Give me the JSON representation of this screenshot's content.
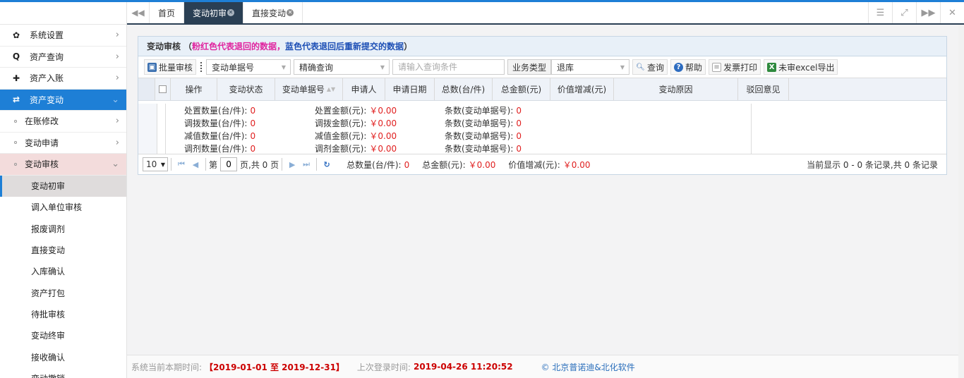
{
  "sidebar": {
    "menu": [
      {
        "icon": "✿",
        "label": "系统设置"
      },
      {
        "icon": "Q",
        "label": "资产查询"
      },
      {
        "icon": "✚",
        "label": "资产入账"
      },
      {
        "icon": "⇄",
        "label": "资产变动"
      }
    ],
    "sub": [
      {
        "label": "在账修改"
      },
      {
        "label": "变动申请"
      },
      {
        "label": "变动审核"
      }
    ],
    "leaves": [
      "变动初审",
      "调入单位审核",
      "报废调剂",
      "直接变动",
      "入库确认",
      "资产打包",
      "待批审核",
      "变动终审",
      "接收确认",
      "变动撤销"
    ]
  },
  "tabs": [
    {
      "label": "首页"
    },
    {
      "label": "变动初审"
    },
    {
      "label": "直接变动"
    }
  ],
  "panel": {
    "title": "变动审核",
    "paren_open": "（",
    "note_pink": "粉红色代表退回的数据，",
    "note_blue": "蓝色代表退回后重新提交的数据",
    "paren_close": "）"
  },
  "toolbar": {
    "batch_label": "批量审核",
    "field_select": "变动单据号",
    "match_select": "精确查询",
    "search_placeholder": "请输入查询条件",
    "biz_type_label": "业务类型",
    "biz_type_value": "退库",
    "query_label": "查询",
    "help_label": "帮助",
    "invoice_label": "发票打印",
    "export_label": "未审excel导出"
  },
  "table": {
    "headers": [
      "操作",
      "变动状态",
      "变动单据号",
      "申请人",
      "申请日期",
      "总数(台/件)",
      "总金额(元)",
      "价值增减(元)",
      "变动原因",
      "驳回意见"
    ]
  },
  "summary": {
    "col1": [
      {
        "label": "处置数量(台/件):",
        "value": "0"
      },
      {
        "label": "调拨数量(台/件):",
        "value": "0"
      },
      {
        "label": "减值数量(台/件):",
        "value": "0"
      },
      {
        "label": "调剂数量(台/件):",
        "value": "0"
      }
    ],
    "col2": [
      {
        "label": "处置金额(元):",
        "value": "￥0.00"
      },
      {
        "label": "调拨金额(元):",
        "value": "￥0.00"
      },
      {
        "label": "减值金额(元):",
        "value": "￥0.00"
      },
      {
        "label": "调剂金额(元):",
        "value": "￥0.00"
      }
    ],
    "col3": [
      {
        "label": "条数(变动单据号):",
        "value": "0"
      },
      {
        "label": "条数(变动单据号):",
        "value": "0"
      },
      {
        "label": "条数(变动单据号):",
        "value": "0"
      },
      {
        "label": "条数(变动单据号):",
        "value": "0"
      }
    ]
  },
  "pager": {
    "page_size": "10",
    "page_prefix": "第",
    "page_value": "0",
    "page_suffix": "页,共 0 页",
    "total_qty_label": "总数量(台/件):",
    "total_qty_value": "0",
    "total_amt_label": "总金额(元):",
    "total_amt_value": "￥0.00",
    "delta_label": "价值增减(元):",
    "delta_value": "￥0.00",
    "record_info": "当前显示 0 - 0 条记录,共 0 条记录"
  },
  "footer": {
    "period_label": "系统当前本期时间:",
    "period_value": "【2019-01-01 至 2019-12-31】",
    "last_login_label": "上次登录时间:",
    "last_login_value": "2019-04-26 11:20:52",
    "copyright": "© 北京普诺迪&北化软件"
  }
}
